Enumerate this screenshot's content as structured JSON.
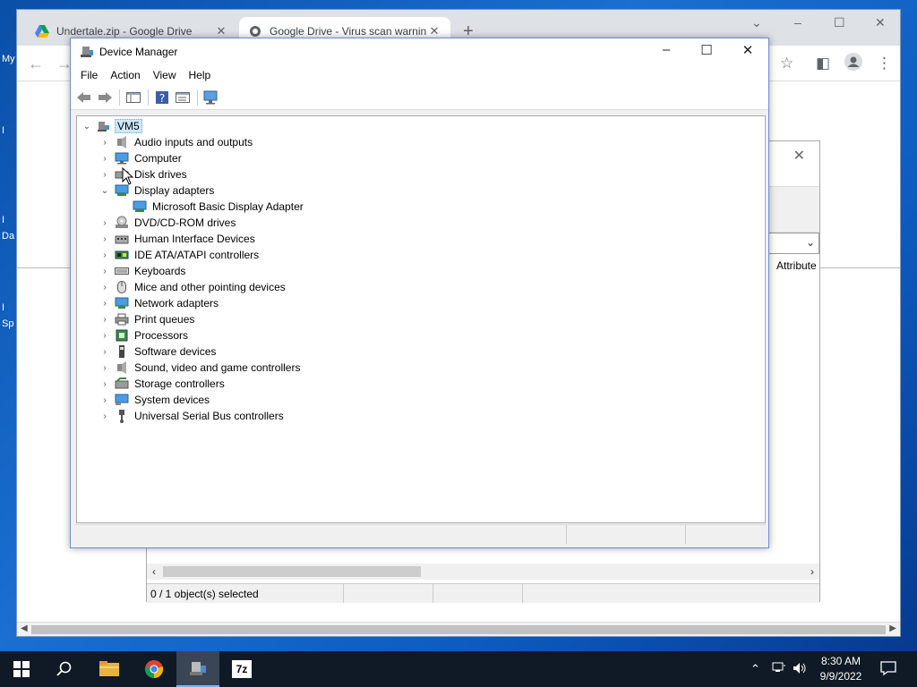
{
  "desktop": {
    "fragments": [
      "My",
      "I",
      "I",
      "Da",
      "I",
      "Sp"
    ]
  },
  "browser": {
    "tabs": [
      {
        "title": "Undertale.zip - Google Drive",
        "icon": "google-drive-icon"
      },
      {
        "title": "Google Drive - Virus scan warnin",
        "icon": "globe-icon"
      }
    ],
    "new_tab": "+",
    "win_controls": [
      "⌄",
      "–",
      "☐",
      "✕"
    ]
  },
  "background_dialog": {
    "column_header": "Attribute",
    "status": "0 / 1 object(s) selected"
  },
  "device_manager": {
    "title": "Device Manager",
    "menu": [
      "File",
      "Action",
      "View",
      "Help"
    ],
    "root": "VM5",
    "categories": [
      {
        "label": "Audio inputs and outputs",
        "icon": "speaker-icon",
        "expanded": false
      },
      {
        "label": "Computer",
        "icon": "monitor-icon",
        "expanded": false
      },
      {
        "label": "Disk drives",
        "icon": "disk-drive-icon",
        "expanded": false
      },
      {
        "label": "Display adapters",
        "icon": "display-adapter-icon",
        "expanded": true
      },
      {
        "label": "Microsoft Basic Display Adapter",
        "icon": "display-adapter-icon",
        "child": true
      },
      {
        "label": "DVD/CD-ROM drives",
        "icon": "dvd-drive-icon",
        "expanded": false
      },
      {
        "label": "Human Interface Devices",
        "icon": "hid-icon",
        "expanded": false
      },
      {
        "label": "IDE ATA/ATAPI controllers",
        "icon": "ide-controller-icon",
        "expanded": false
      },
      {
        "label": "Keyboards",
        "icon": "keyboard-icon",
        "expanded": false
      },
      {
        "label": "Mice and other pointing devices",
        "icon": "mouse-icon",
        "expanded": false
      },
      {
        "label": "Network adapters",
        "icon": "network-adapter-icon",
        "expanded": false
      },
      {
        "label": "Print queues",
        "icon": "printer-icon",
        "expanded": false
      },
      {
        "label": "Processors",
        "icon": "processor-icon",
        "expanded": false
      },
      {
        "label": "Software devices",
        "icon": "software-device-icon",
        "expanded": false
      },
      {
        "label": "Sound, video and game controllers",
        "icon": "speaker-icon",
        "expanded": false
      },
      {
        "label": "Storage controllers",
        "icon": "storage-controller-icon",
        "expanded": false
      },
      {
        "label": "System devices",
        "icon": "system-device-icon",
        "expanded": false
      },
      {
        "label": "Universal Serial Bus controllers",
        "icon": "usb-icon",
        "expanded": false
      }
    ]
  },
  "taskbar": {
    "items": [
      "start-icon",
      "search-icon",
      "file-explorer-icon",
      "chrome-icon",
      "device-manager-icon",
      "7zip-icon"
    ],
    "clock_time": "8:30 AM",
    "clock_date": "9/9/2022",
    "sevenzip_label": "7z"
  }
}
